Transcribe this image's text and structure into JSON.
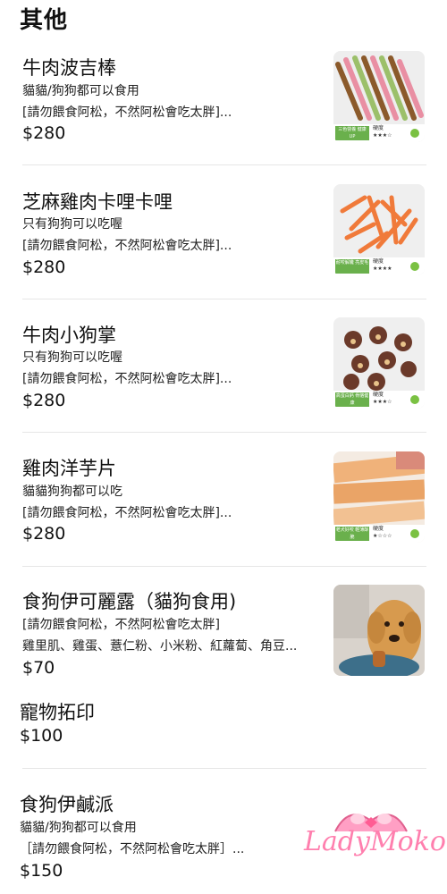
{
  "section": {
    "title": "其他"
  },
  "items": [
    {
      "name": "牛肉波吉棒",
      "line1": "貓貓/狗狗都可以食用",
      "line2": "[請勿餵食阿松，不然阿松會吃太胖]...",
      "price": "$280",
      "thumb": {
        "tag": "三色營養 健康UP",
        "hardness_label": "硬度",
        "stars": "★★★☆"
      }
    },
    {
      "name": "芝麻雞肉卡哩卡哩",
      "line1": "只有狗狗可以吃喔",
      "line2": "[請勿餵食阿松，不然阿松會吃太胖]...",
      "price": "$280",
      "thumb": {
        "tag": "耐咬解饞 亮皮毛",
        "hardness_label": "硬度",
        "stars": "★★★★"
      }
    },
    {
      "name": "牛肉小狗掌",
      "line1": "只有狗狗可以吃喔",
      "line2": "[請勿餵食阿松，不然阿松會吃太胖]...",
      "price": "$280",
      "thumb": {
        "tag": "高蛋白鈣 骨骼健康",
        "hardness_label": "硬度",
        "stars": "★★★☆"
      }
    },
    {
      "name": "雞肉洋芋片",
      "line1": "貓貓狗狗都可以吃",
      "line2": "[請勿餵食阿松，不然阿松會吃太胖]...",
      "price": "$280",
      "thumb": {
        "tag": "老犬好咬 輕薄酥脆",
        "hardness_label": "硬度",
        "stars": "★☆☆☆"
      }
    },
    {
      "name": "食狗伊可麗露（貓狗食用)",
      "line1": "[請勿餵食阿松，不然阿松會吃太胖]",
      "line2": "雞里肌、雞蛋、薏仁粉、小米粉、紅蘿蔔、角豆...",
      "price": "$70"
    },
    {
      "name": "寵物拓印",
      "price": "$100"
    },
    {
      "name": "食狗伊鹹派",
      "line1": "貓貓/狗狗都可以食用",
      "line2": "［請勿餵食阿松，不然阿松會吃太胖］...",
      "price": "$150"
    }
  ],
  "watermark": {
    "text": "LadyMoko"
  },
  "colors": {
    "accent_green": "#7ac142",
    "watermark_pink": "#ff7fae"
  }
}
